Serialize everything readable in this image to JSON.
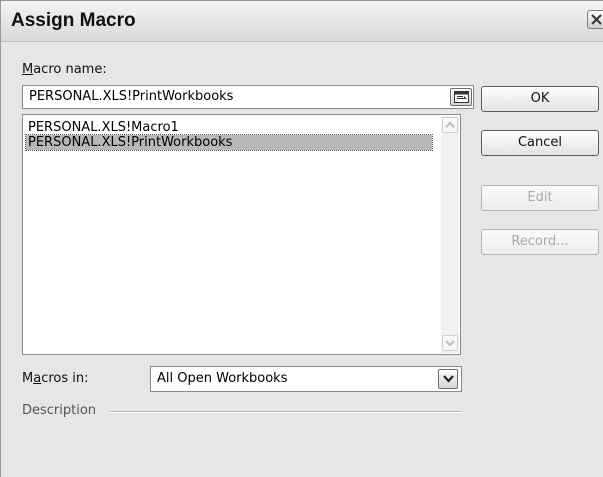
{
  "dialog": {
    "title": "Assign Macro",
    "close_icon": "close-icon"
  },
  "macro_name": {
    "label_prefix": "",
    "label_underline": "M",
    "label_rest": "acro name:",
    "value": "PERSONAL.XLS!PrintWorkbooks",
    "collapse_icon": "collapse-dialog-icon"
  },
  "macro_list": {
    "items": [
      {
        "label": "PERSONAL.XLS!Macro1",
        "selected": false
      },
      {
        "label": "PERSONAL.XLS!PrintWorkbooks",
        "selected": true
      }
    ],
    "scroll_up_icon": "scroll-up-icon",
    "scroll_down_icon": "scroll-down-icon"
  },
  "buttons": {
    "ok": "OK",
    "cancel": "Cancel",
    "edit": "Edit",
    "record": "Record..."
  },
  "macros_in": {
    "label_prefix": "M",
    "label_underline": "a",
    "label_rest": "cros in:",
    "selected": "All Open Workbooks",
    "dropdown_icon": "chevron-down-icon"
  },
  "description": {
    "label": "Description"
  },
  "colors": {
    "dialog_bg": "#e6e6e6",
    "selection": "#b8b8b8",
    "disabled_text": "#a9a9a9"
  }
}
